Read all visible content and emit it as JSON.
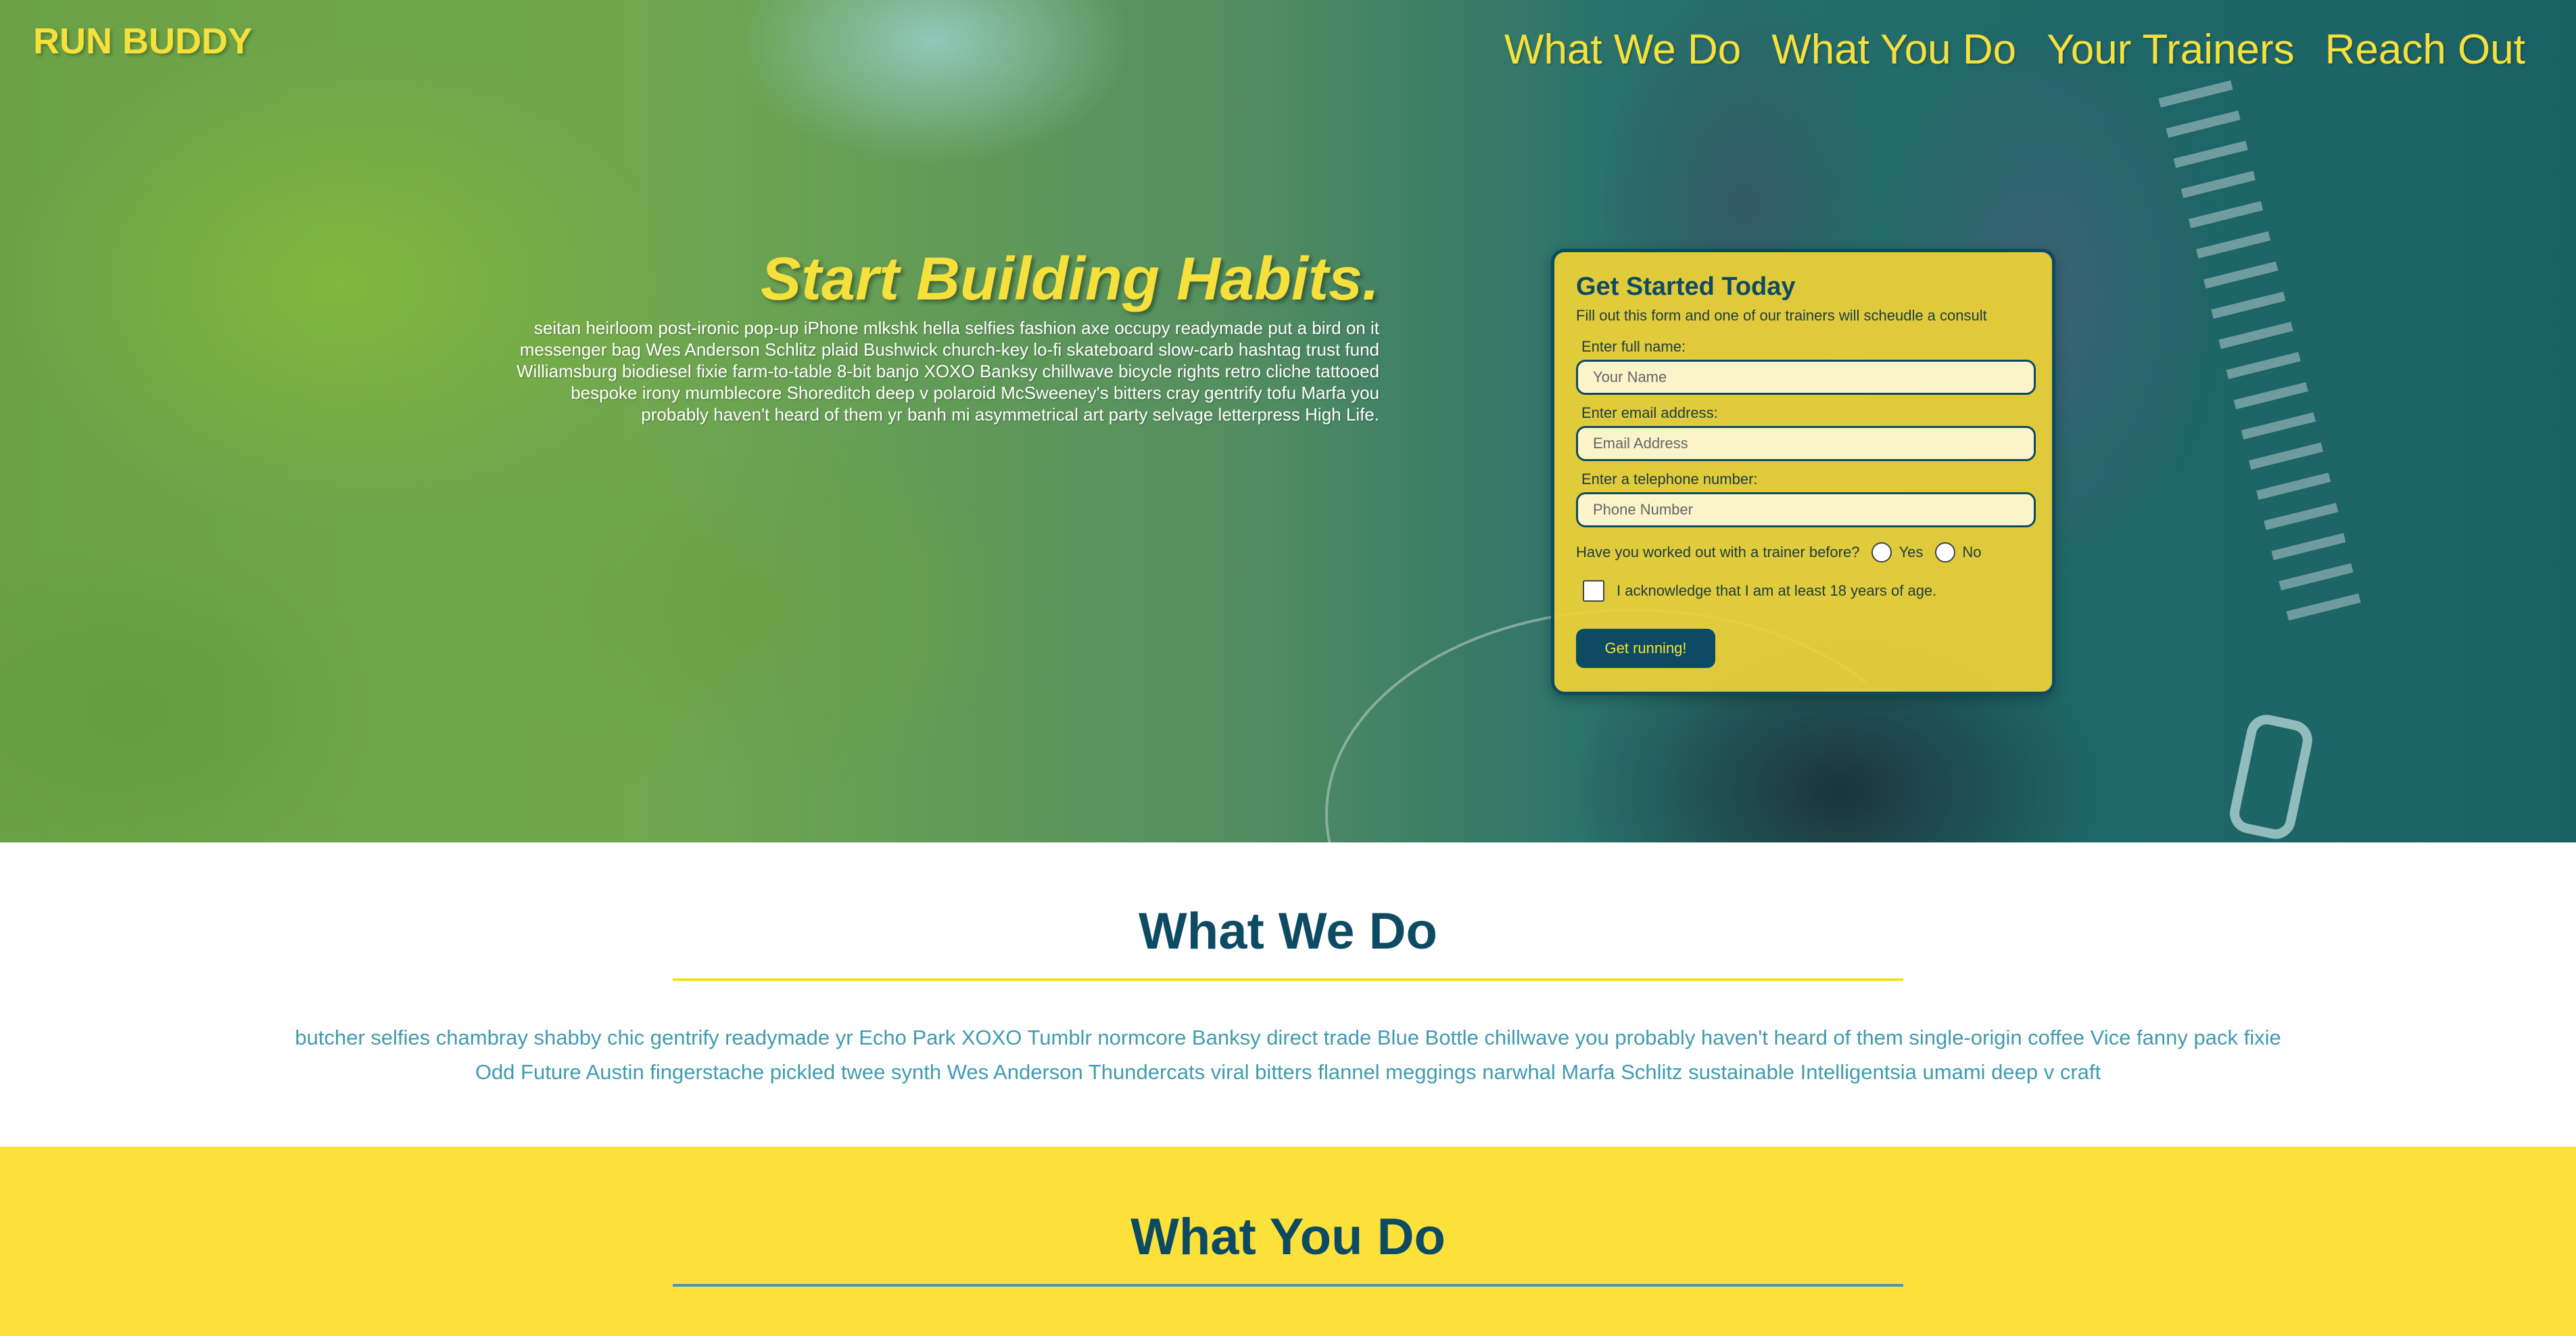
{
  "header": {
    "brand": "RUN BUDDY",
    "nav": [
      "What We Do",
      "What You Do",
      "Your Trainers",
      "Reach Out"
    ]
  },
  "hero": {
    "title": "Start Building Habits.",
    "text": "seitan heirloom post-ironic pop-up iPhone mlkshk hella selfies fashion axe occupy readymade put a bird on it messenger bag Wes Anderson Schlitz plaid Bushwick church-key lo-fi skateboard slow-carb hashtag trust fund Williamsburg biodiesel fixie farm-to-table 8-bit banjo XOXO Banksy chillwave bicycle rights retro cliche tattooed bespoke irony mumblecore Shoreditch deep v polaroid McSweeney's bitters cray gentrify tofu Marfa you probably haven't heard of them yr banh mi asymmetrical art party selvage letterpress High Life."
  },
  "form": {
    "title": "Get Started Today",
    "subtitle": "Fill out this form and one of our trainers will scheudle a consult",
    "name_label": "Enter full name:",
    "name_placeholder": "Your Name",
    "email_label": "Enter email address:",
    "email_placeholder": "Email Address",
    "phone_label": "Enter a telephone number:",
    "phone_placeholder": "Phone Number",
    "trainer_question": "Have you worked out with a trainer before?",
    "option_yes": "Yes",
    "option_no": "No",
    "age_ack": "I acknowledge that I am at least 18 years of age.",
    "submit": "Get running!"
  },
  "what_we_do": {
    "title": "What We Do",
    "body": "butcher selfies chambray shabby chic gentrify readymade yr Echo Park XOXO Tumblr normcore Banksy direct trade Blue Bottle chillwave you probably haven't heard of them single-origin coffee Vice fanny pack fixie Odd Future Austin fingerstache pickled twee synth Wes Anderson Thundercats viral bitters flannel meggings narwhal Marfa Schlitz sustainable Intelligentsia umami deep v craft"
  },
  "what_you_do": {
    "title": "What You Do"
  },
  "colors": {
    "brand_yellow": "#f6e03b",
    "brand_navy": "#0d4b63",
    "teal_text": "#3f9bb0",
    "section_yellow": "#fbe13a"
  }
}
